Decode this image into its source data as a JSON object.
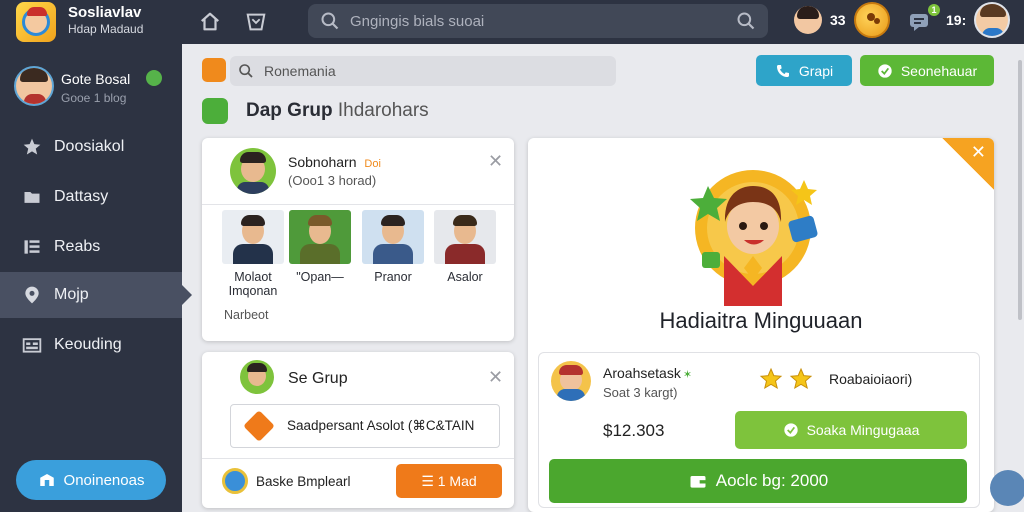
{
  "app": {
    "title": "Sosliavlav",
    "subtitle": "Hdap Madaud"
  },
  "topbar": {
    "search_placeholder": "Gngingis bials suoai",
    "user_count": "33",
    "message_count": "19:",
    "message_badge": "1"
  },
  "sidebar": {
    "profile": {
      "name": "Gote Bosal",
      "status": "Gooe 1 blog"
    },
    "items": [
      {
        "label": "Doosiakol",
        "icon": "star-icon"
      },
      {
        "label": "Dattasy",
        "icon": "folder-icon"
      },
      {
        "label": "Reabs",
        "icon": "list-icon"
      },
      {
        "label": "Mojp",
        "icon": "map-pin-icon",
        "active": true
      },
      {
        "label": "Keouding",
        "icon": "grid-icon"
      }
    ],
    "bottom_button": "Onoinenoas"
  },
  "main": {
    "search_value": "Ronemania",
    "call_button": "Grapi",
    "primary_button": "Seonehauar",
    "section_title_bold": "Dap Grup",
    "section_title_rest": "Ihdarohars"
  },
  "friends_card": {
    "name": "Sobnoharn",
    "tag": "Doi",
    "status": "(Ooo1 3 horad)",
    "friends": [
      {
        "name": "Molaot Imqonan"
      },
      {
        "name": "\"Opan—"
      },
      {
        "name": "Pranor"
      },
      {
        "name": "Asalor"
      }
    ],
    "footer": "Narbeot"
  },
  "group_card": {
    "title": "Se Grup",
    "field_text": "Saadpersant Asolot (⌘C&TAIN",
    "footer_text": "Baske Bmplearl",
    "action_button": "☰ 1 Mad"
  },
  "reward": {
    "title": "Hadiaitra Minguuaan",
    "user_name": "Aroahsetask",
    "user_status": "Soat 3 kargt)",
    "rating_label": "Roabaioiaori)",
    "amount": "$12.303",
    "secondary_button": "Soaka Mingugaaa",
    "main_button": "Aoclc bg: 2000"
  },
  "colors": {
    "topbar": "#2d3342",
    "accent_blue": "#2ea4c9",
    "accent_green": "#5cb836",
    "orange": "#ef7a1a"
  }
}
